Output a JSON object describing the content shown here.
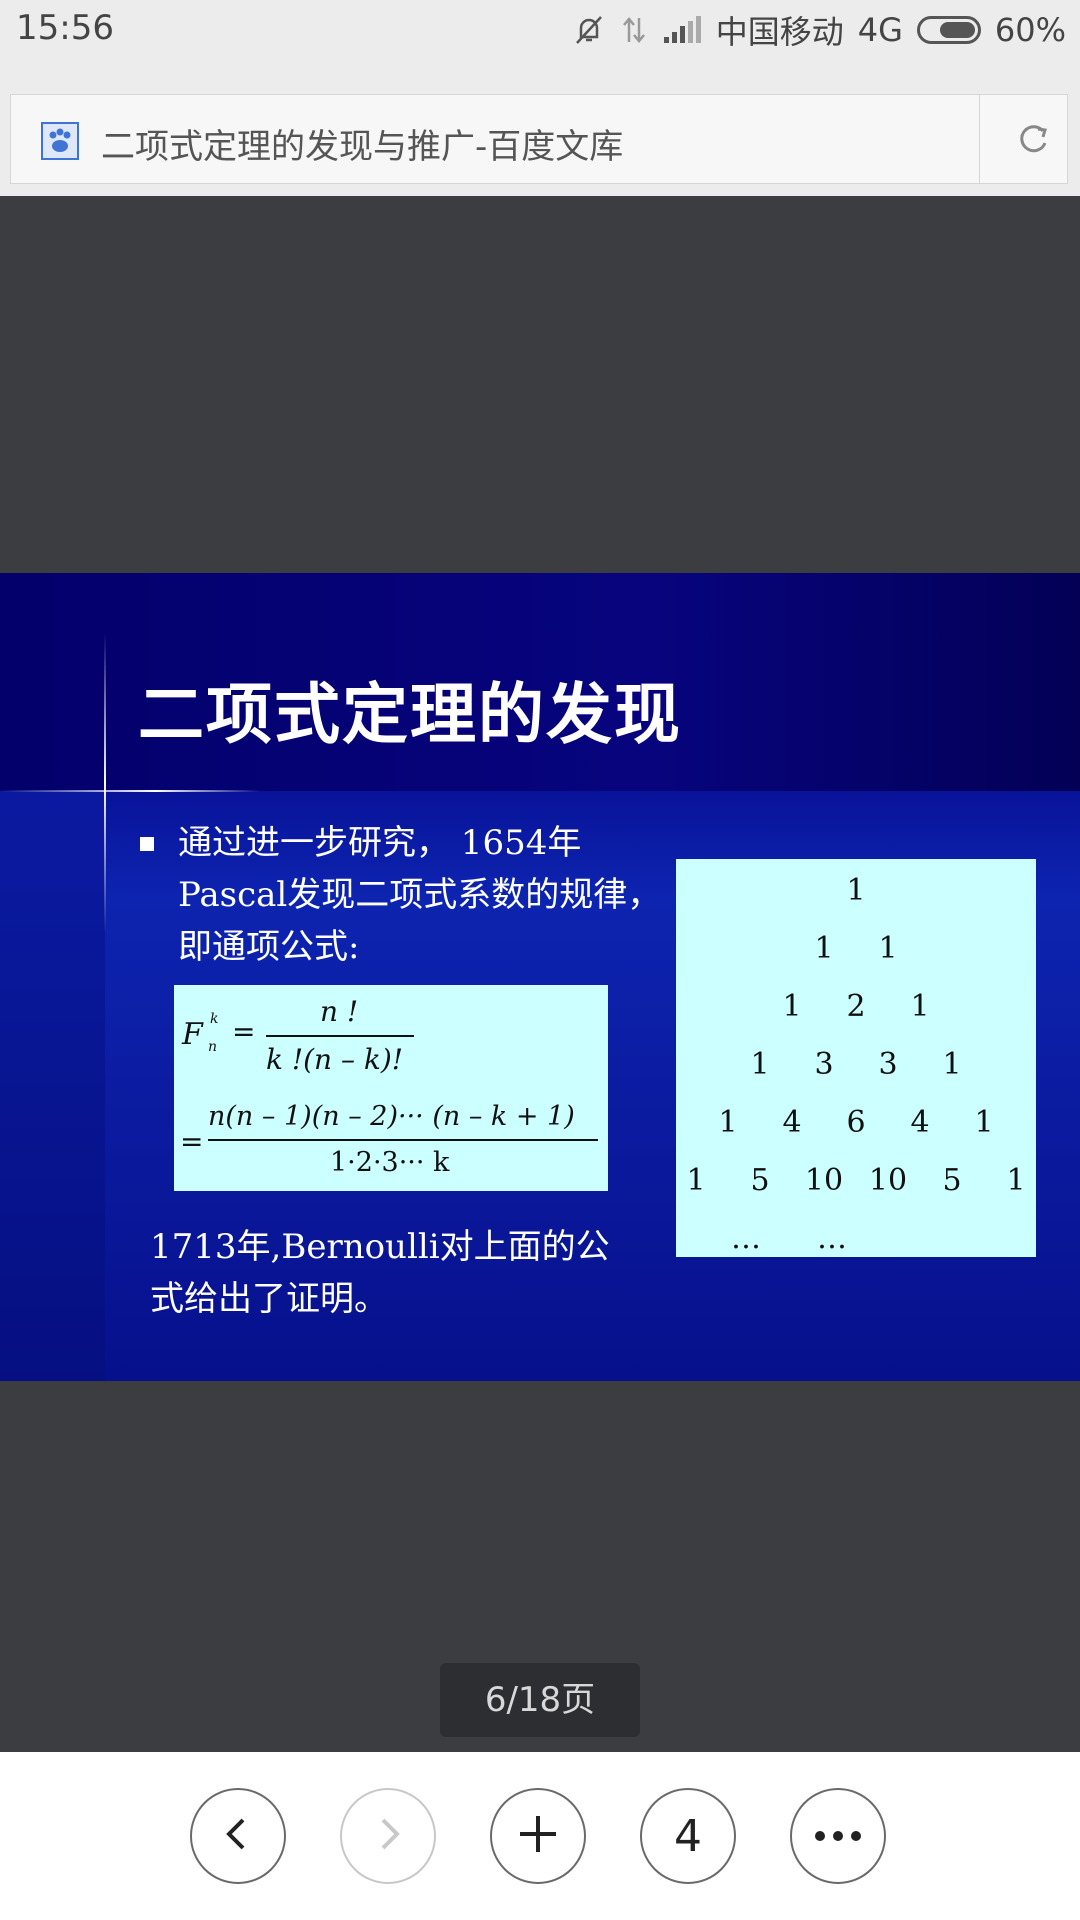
{
  "status_bar": {
    "time": "15:56",
    "carrier": "中国移动",
    "network": "4G",
    "battery": "60%"
  },
  "browser": {
    "page_title": "二项式定理的发现与推广-百度文库"
  },
  "slide": {
    "title": "二项式定理的发现",
    "bullet_text": "通过进一步研究， 1654年Pascal发现二项式系数的规律，即通项公式:",
    "formula": {
      "lhs_symbol": "F",
      "sup": "k",
      "sub": "n",
      "eq": "=",
      "numerator_1": "n !",
      "denominator_1": "k !(n – k)!",
      "numerator_2": "n(n – 1)(n – 2)··· (n – k + 1)",
      "denominator_2": "1·2·3··· k"
    },
    "conclusion": "1713年,Bernoulli对上面的公式给出了证明。",
    "pascal_triangle": [
      [
        "1"
      ],
      [
        "1",
        "1"
      ],
      [
        "1",
        "2",
        "1"
      ],
      [
        "1",
        "3",
        "3",
        "1"
      ],
      [
        "1",
        "4",
        "6",
        "4",
        "1"
      ],
      [
        "1",
        "5",
        "10",
        "10",
        "5",
        "1"
      ],
      [
        "…",
        "…"
      ]
    ]
  },
  "pager": {
    "label": "6/18页"
  },
  "toolbar": {
    "tab_count": "4",
    "buttons": [
      "back-icon",
      "forward-icon",
      "plus-icon",
      "tabs",
      "more-icon"
    ]
  }
}
